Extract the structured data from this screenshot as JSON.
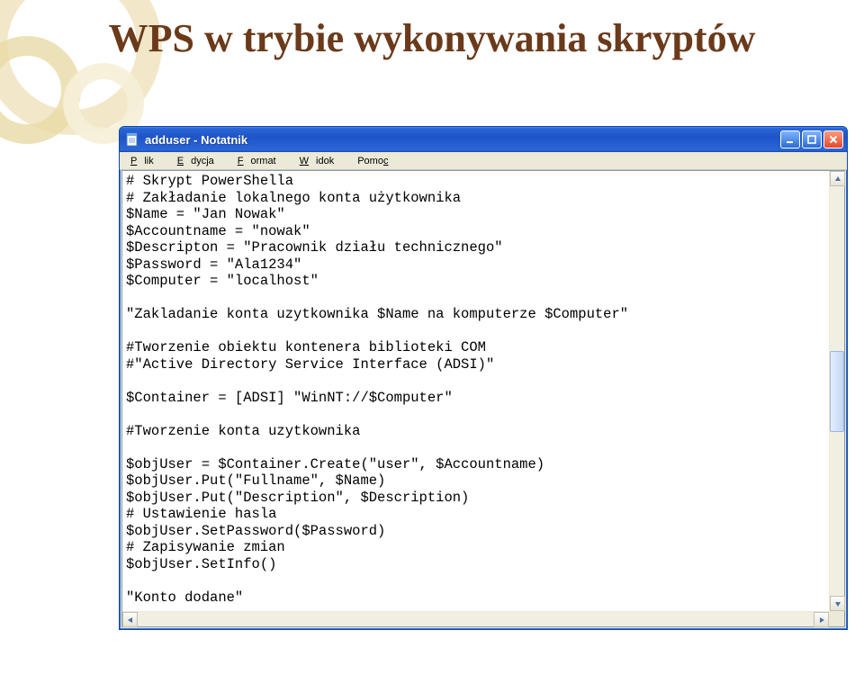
{
  "slide": {
    "title": "WPS w trybie wykonywania skryptów"
  },
  "window": {
    "title": "adduser - Notatnik",
    "icon_name": "notepad-icon"
  },
  "menubar": {
    "items": [
      {
        "label": "Plik",
        "uchar": "P",
        "rest": "lik"
      },
      {
        "label": "Edycja",
        "uchar": "E",
        "rest": "dycja"
      },
      {
        "label": "Format",
        "uchar": "F",
        "rest": "ormat"
      },
      {
        "label": "Widok",
        "uchar": "W",
        "rest": "idok"
      },
      {
        "label": "Pomoc",
        "uchar": "P",
        "rest": "omoc",
        "uindex": 4
      }
    ]
  },
  "editor": {
    "content": "# Skrypt PowerShella\n# Zakładanie lokalnego konta użytkownika\n$Name = \"Jan Nowak\"\n$Accountname = \"nowak\"\n$Descripton = \"Pracownik działu technicznego\"\n$Password = \"Ala1234\"\n$Computer = \"localhost\"\n\n\"Zakladanie konta uzytkownika $Name na komputerze $Computer\"\n\n#Tworzenie obiektu kontenera biblioteki COM\n#\"Active Directory Service Interface (ADSI)\"\n\n$Container = [ADSI] \"WinNT://$Computer\"\n\n#Tworzenie konta uzytkownika\n\n$objUser = $Container.Create(\"user\", $Accountname)\n$objUser.Put(\"Fullname\", $Name)\n$objUser.Put(\"Description\", $Description)\n# Ustawienie hasla\n$objUser.SetPassword($Password)\n# Zapisywanie zmian\n$objUser.SetInfo()\n\n\"Konto dodane\""
  },
  "colors": {
    "title_text": "#6b3a1a",
    "xp_blue_top": "#4a8ef2",
    "xp_blue_bottom": "#1a47a7",
    "close_red": "#e2492d",
    "chrome_bg": "#ece9d8"
  }
}
